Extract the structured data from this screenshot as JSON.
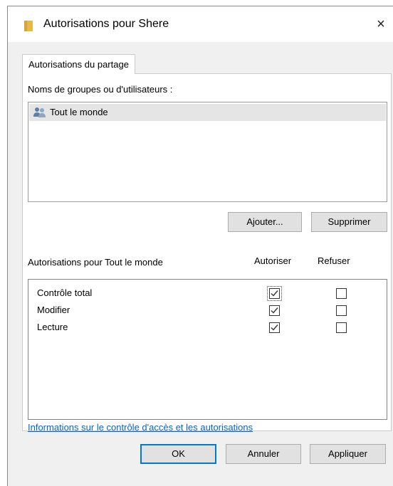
{
  "window": {
    "title": "Autorisations pour Shere",
    "close_glyph": "×"
  },
  "tab": {
    "label": "Autorisations du partage"
  },
  "groups": {
    "label": "Noms de groupes ou d'utilisateurs :",
    "items": [
      {
        "label": "Tout le monde",
        "icon": "users-icon",
        "selected": true
      }
    ]
  },
  "buttons": {
    "add": "Ajouter...",
    "remove": "Supprimer",
    "ok": "OK",
    "cancel": "Annuler",
    "apply": "Appliquer"
  },
  "permissions": {
    "label": "Autorisations pour Tout le monde",
    "col_allow": "Autoriser",
    "col_deny": "Refuser",
    "rows": [
      {
        "name": "Contrôle total",
        "allow": true,
        "deny": false
      },
      {
        "name": "Modifier",
        "allow": true,
        "deny": false
      },
      {
        "name": "Lecture",
        "allow": true,
        "deny": false
      }
    ]
  },
  "link": {
    "text": "Informations sur le contrôle d'accès et les autorisations"
  },
  "colors": {
    "accent": "#0078d7",
    "link": "#0066cc",
    "selection": "#e5e5e5"
  }
}
